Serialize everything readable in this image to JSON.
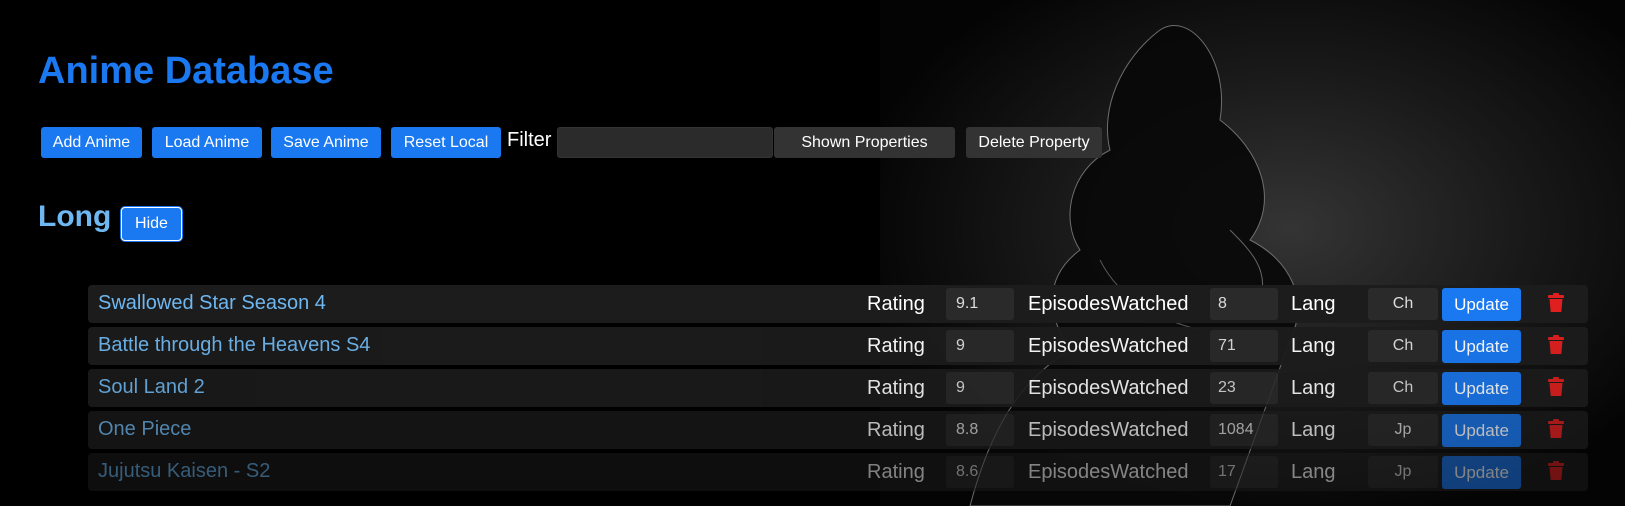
{
  "app": {
    "title": "Anime Database"
  },
  "toolbar": {
    "add_label": "Add Anime",
    "load_label": "Load Anime",
    "save_label": "Save Anime",
    "reset_label": "Reset Local",
    "filter_label": "Filter",
    "filter_value": "",
    "shown_properties_label": "Shown Properties",
    "delete_property_label": "Delete Property"
  },
  "section": {
    "title": "Long",
    "hide_label": "Hide"
  },
  "columns": {
    "rating": "Rating",
    "episodes": "EpisodesWatched",
    "lang": "Lang"
  },
  "rows": [
    {
      "title": "Swallowed Star Season 4",
      "rating": "9.1",
      "episodes": "8",
      "lang": "Ch",
      "update": "Update",
      "opacity": 1.0
    },
    {
      "title": "Battle through the Heavens S4",
      "rating": "9",
      "episodes": "71",
      "lang": "Ch",
      "update": "Update",
      "opacity": 0.95
    },
    {
      "title": "Soul Land 2",
      "rating": "9",
      "episodes": "23",
      "lang": "Ch",
      "update": "Update",
      "opacity": 0.88
    },
    {
      "title": "One Piece",
      "rating": "8.8",
      "episodes": "1084",
      "lang": "Jp",
      "update": "Update",
      "opacity": 0.72
    },
    {
      "title": "Jujutsu Kaisen - S2",
      "rating": "8.6",
      "episodes": "17",
      "lang": "Jp",
      "update": "Update",
      "opacity": 0.5
    }
  ],
  "icons": {
    "delete": "trash-icon"
  },
  "colors": {
    "accent": "#1a78f0",
    "title_link": "#6fb7f0",
    "delete": "#e02020"
  }
}
